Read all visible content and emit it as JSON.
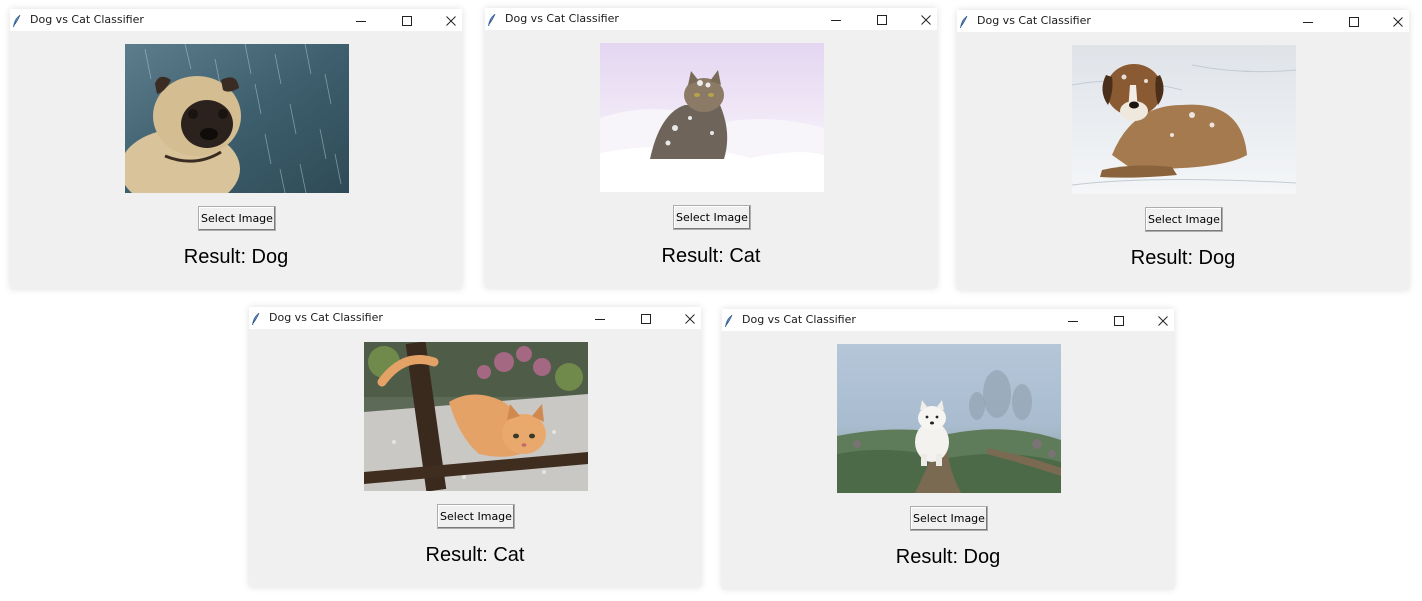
{
  "windows": [
    {
      "title": "Dog vs Cat Classifier",
      "button_label": "Select Image",
      "result_text": "Result: Dog",
      "photo": "pug in the rain"
    },
    {
      "title": "Dog vs Cat Classifier",
      "button_label": "Select Image",
      "result_text": "Result: Cat",
      "photo": "tabby cat in snow"
    },
    {
      "title": "Dog vs Cat Classifier",
      "button_label": "Select Image",
      "result_text": "Result: Dog",
      "photo": "saint bernard lying in snow"
    },
    {
      "title": "Dog vs Cat Classifier",
      "button_label": "Select Image",
      "result_text": "Result: Cat",
      "photo": "orange kitten under wooden chair"
    },
    {
      "title": "Dog vs Cat Classifier",
      "button_label": "Select Image",
      "result_text": "Result: Dog",
      "photo": "white samoyed on foggy path"
    }
  ],
  "icons": {
    "app": "feather-icon",
    "minimize": "minimize-icon",
    "maximize": "maximize-icon",
    "close": "close-icon"
  },
  "colors": {
    "window_background": "#f0f0f0",
    "titlebar_background": "#ffffff",
    "button_border": "#adadad"
  }
}
